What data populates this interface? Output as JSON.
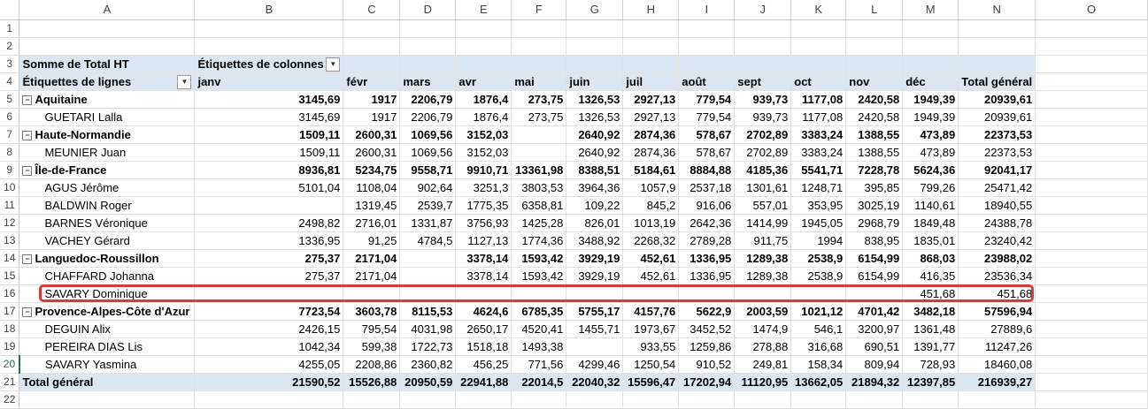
{
  "columns": [
    "A",
    "B",
    "C",
    "D",
    "E",
    "F",
    "G",
    "H",
    "I",
    "J",
    "K",
    "L",
    "M",
    "N",
    "O"
  ],
  "pivot": {
    "title": "Somme de Total HT",
    "col_labels": "Étiquettes de colonnes",
    "row_labels": "Étiquettes de lignes",
    "months": [
      "janv",
      "févr",
      "mars",
      "avr",
      "mai",
      "juin",
      "juil",
      "août",
      "sept",
      "oct",
      "nov",
      "déc",
      "Total général"
    ]
  },
  "rows": [
    {
      "n": "1",
      "type": "empty"
    },
    {
      "n": "2",
      "type": "empty"
    },
    {
      "n": "3",
      "type": "hdr1"
    },
    {
      "n": "4",
      "type": "hdr2"
    },
    {
      "n": "5",
      "type": "group",
      "label": "Aquitaine",
      "values": [
        "3145,69",
        "1917",
        "2206,79",
        "1876,4",
        "273,75",
        "1326,53",
        "2927,13",
        "779,54",
        "939,73",
        "1177,08",
        "2420,58",
        "1949,39",
        "20939,61"
      ]
    },
    {
      "n": "6",
      "type": "item",
      "label": "GUETARI Lalla",
      "values": [
        "3145,69",
        "1917",
        "2206,79",
        "1876,4",
        "273,75",
        "1326,53",
        "2927,13",
        "779,54",
        "939,73",
        "1177,08",
        "2420,58",
        "1949,39",
        "20939,61"
      ]
    },
    {
      "n": "7",
      "type": "group",
      "label": "Haute-Normandie",
      "values": [
        "1509,11",
        "2600,31",
        "1069,56",
        "3152,03",
        "",
        "2640,92",
        "2874,36",
        "578,67",
        "2702,89",
        "3383,24",
        "1388,55",
        "473,89",
        "22373,53"
      ]
    },
    {
      "n": "8",
      "type": "item",
      "label": "MEUNIER Juan",
      "values": [
        "1509,11",
        "2600,31",
        "1069,56",
        "3152,03",
        "",
        "2640,92",
        "2874,36",
        "578,67",
        "2702,89",
        "3383,24",
        "1388,55",
        "473,89",
        "22373,53"
      ]
    },
    {
      "n": "9",
      "type": "group",
      "label": "Île-de-France",
      "values": [
        "8936,81",
        "5234,75",
        "9558,71",
        "9910,71",
        "13361,98",
        "8388,51",
        "5184,61",
        "8884,88",
        "4185,36",
        "5541,71",
        "7228,78",
        "5624,36",
        "92041,17"
      ]
    },
    {
      "n": "10",
      "type": "item",
      "label": "AGUS Jérôme",
      "values": [
        "5101,04",
        "1108,04",
        "902,64",
        "3251,3",
        "3803,53",
        "3964,36",
        "1057,9",
        "2537,18",
        "1301,61",
        "1248,71",
        "395,85",
        "799,26",
        "25471,42"
      ]
    },
    {
      "n": "11",
      "type": "item",
      "label": "BALDWIN Roger",
      "values": [
        "",
        "1319,45",
        "2539,7",
        "1775,35",
        "6358,81",
        "109,22",
        "845,2",
        "916,06",
        "557,01",
        "353,95",
        "3025,19",
        "1140,61",
        "18940,55"
      ]
    },
    {
      "n": "12",
      "type": "item",
      "label": "BARNES Véronique",
      "values": [
        "2498,82",
        "2716,01",
        "1331,87",
        "3756,93",
        "1425,28",
        "826,01",
        "1013,19",
        "2642,36",
        "1414,99",
        "1945,05",
        "2968,79",
        "1849,48",
        "24388,78"
      ]
    },
    {
      "n": "13",
      "type": "item",
      "label": "VACHEY Gérard",
      "values": [
        "1336,95",
        "91,25",
        "4784,5",
        "1127,13",
        "1774,36",
        "3488,92",
        "2268,32",
        "2789,28",
        "911,75",
        "1994",
        "838,95",
        "1835,01",
        "23240,42"
      ]
    },
    {
      "n": "14",
      "type": "group",
      "label": "Languedoc-Roussillon",
      "values": [
        "275,37",
        "2171,04",
        "",
        "3378,14",
        "1593,42",
        "3929,19",
        "452,61",
        "1336,95",
        "1289,38",
        "2538,9",
        "6154,99",
        "868,03",
        "23988,02"
      ]
    },
    {
      "n": "15",
      "type": "item",
      "label": "CHAFFARD Johanna",
      "values": [
        "275,37",
        "2171,04",
        "",
        "3378,14",
        "1593,42",
        "3929,19",
        "452,61",
        "1336,95",
        "1289,38",
        "2538,9",
        "6154,99",
        "416,35",
        "23536,34"
      ]
    },
    {
      "n": "16",
      "type": "item",
      "label": "SAVARY Dominique",
      "values": [
        "",
        "",
        "",
        "",
        "",
        "",
        "",
        "",
        "",
        "",
        "",
        "451,68",
        "451,68"
      ]
    },
    {
      "n": "17",
      "type": "group",
      "label": "Provence-Alpes-Côte d'Azur",
      "values": [
        "7723,54",
        "3603,78",
        "8115,53",
        "4624,6",
        "6785,35",
        "5755,17",
        "4157,76",
        "5622,9",
        "2003,59",
        "1021,12",
        "4701,42",
        "3482,18",
        "57596,94"
      ]
    },
    {
      "n": "18",
      "type": "item",
      "label": "DEGUIN Alix",
      "values": [
        "2426,15",
        "795,54",
        "4031,98",
        "2650,17",
        "4520,41",
        "1455,71",
        "1973,67",
        "3452,52",
        "1474,9",
        "546,1",
        "3200,97",
        "1361,48",
        "27889,6"
      ]
    },
    {
      "n": "19",
      "type": "item",
      "label": "PEREIRA DIAS Lis",
      "values": [
        "1042,34",
        "599,38",
        "1722,73",
        "1518,18",
        "1493,38",
        "",
        "933,55",
        "1259,86",
        "278,88",
        "316,68",
        "690,51",
        "1391,77",
        "11247,26"
      ]
    },
    {
      "n": "20",
      "type": "item",
      "label": "SAVARY Yasmina",
      "values": [
        "4255,05",
        "2208,86",
        "2360,82",
        "456,25",
        "771,56",
        "4299,46",
        "1250,54",
        "910,52",
        "249,81",
        "158,34",
        "809,94",
        "728,93",
        "18460,08"
      ]
    },
    {
      "n": "21",
      "type": "total",
      "label": "Total général",
      "values": [
        "21590,52",
        "15526,88",
        "20950,59",
        "22941,88",
        "22014,5",
        "22040,32",
        "15596,47",
        "17202,94",
        "11120,95",
        "13662,05",
        "21894,32",
        "12397,85",
        "216939,27"
      ]
    },
    {
      "n": "22",
      "type": "empty"
    }
  ]
}
